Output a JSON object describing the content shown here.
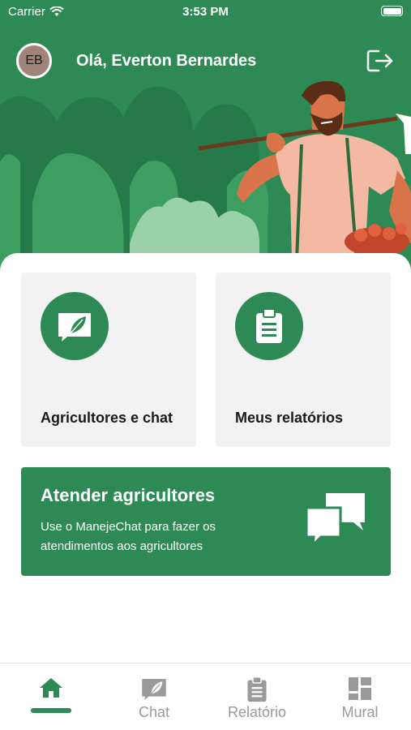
{
  "status_bar": {
    "carrier": "Carrier",
    "time": "3:53 PM",
    "battery_level": 1.0
  },
  "header": {
    "avatar_initials": "EB",
    "greeting": "Olá, Everton Bernardes",
    "logout_icon": "logout-icon"
  },
  "cards": [
    {
      "label": "Agricultores e chat",
      "icon": "leaf-chat-icon"
    },
    {
      "label": "Meus relatórios",
      "icon": "clipboard-icon"
    }
  ],
  "banner": {
    "title": "Atender agricultores",
    "description": "Use o ManejeChat para fazer os atendimentos aos agricultores",
    "icon": "chat-bubbles-icon"
  },
  "tabbar": {
    "tabs": [
      {
        "label": "",
        "icon": "home-icon",
        "active": true
      },
      {
        "label": "Chat",
        "icon": "leaf-chat-icon",
        "active": false
      },
      {
        "label": "Relatório",
        "icon": "clipboard-icon",
        "active": false
      },
      {
        "label": "Mural",
        "icon": "grid-icon",
        "active": false
      }
    ]
  },
  "colors": {
    "primary": "#2e8a55",
    "card_bg": "#f2f2f2",
    "inactive": "#9a9a9a"
  }
}
